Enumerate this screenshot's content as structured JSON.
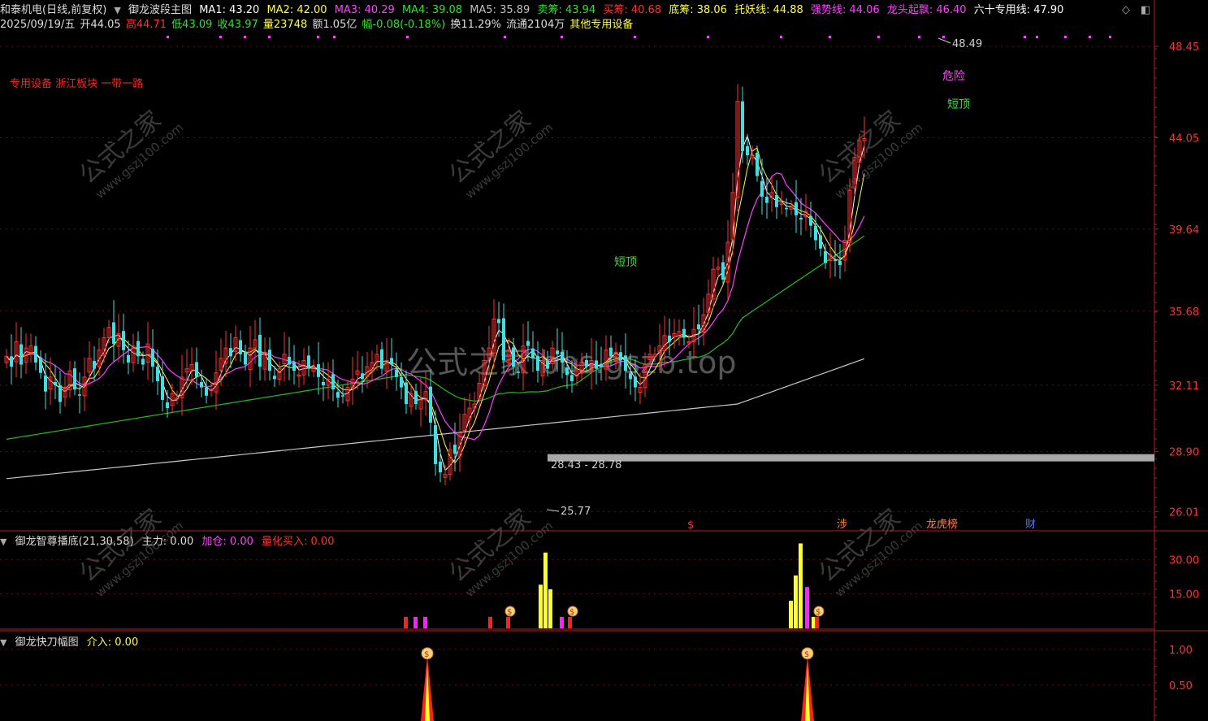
{
  "header": {
    "stock": "和泰机电(日线,前复权)",
    "main_indicator": "御龙波段主图",
    "ma": [
      {
        "label": "MA1: 43.20",
        "color": "#ffffff"
      },
      {
        "label": "MA2: 42.00",
        "color": "#ffff40"
      },
      {
        "label": "MA3: 40.29",
        "color": "#ff40ff"
      },
      {
        "label": "MA4: 39.08",
        "color": "#30e030"
      },
      {
        "label": "MA5: 35.89",
        "color": "#c0c0c0"
      },
      {
        "label": "卖筹: 43.94",
        "color": "#30e030"
      },
      {
        "label": "买筹: 40.68",
        "color": "#ff3030"
      },
      {
        "label": "底筹: 38.06",
        "color": "#ffff40"
      },
      {
        "label": "托妖线: 44.88",
        "color": "#ffff40"
      },
      {
        "label": "强势线: 44.06",
        "color": "#ff40ff"
      },
      {
        "label": "龙头起飘: 46.40",
        "color": "#ff40ff"
      },
      {
        "label": "六十专用线: 47.90",
        "color": "#ffffff"
      }
    ]
  },
  "quote": {
    "date": "2025/09/19/五",
    "open": "开44.05",
    "high": "高44.71",
    "low": "低43.09",
    "close": "收43.97",
    "volume": "量23748",
    "amount": "额1.05亿",
    "change": "幅-0.08(-0.18%)",
    "turnover": "换11.29%",
    "float": "流通2104万",
    "industry": "其他专用设备"
  },
  "tags": "专用设备 浙江板块 一带一路",
  "annotations": {
    "danger": "危险",
    "short_top_1": "短顶",
    "short_top_2": "短顶",
    "high_label": "48.49",
    "low_label": "25.77",
    "range_label": "28.43 - 28.78"
  },
  "events": [
    {
      "label": "$",
      "color": "#ff3030"
    },
    {
      "label": "涉",
      "color": "#ff8040"
    },
    {
      "label": "龙虎榜",
      "color": "#ff8040"
    },
    {
      "label": "财",
      "color": "#4080ff"
    }
  ],
  "panel2": {
    "title": "御龙智尊播底(21,30,58)",
    "zhuli": "主力: 0.00",
    "jiacang": "加仓: 0.00",
    "lianghua": "量化买入: 0.00"
  },
  "panel3": {
    "title": "御龙快刀幅图",
    "jieru": "介入: 0.00"
  },
  "watermark": {
    "center": "公式之家 bbs.gszb.top",
    "diag_cn": "公式之家",
    "diag_url": "www.gszj100.com"
  },
  "chart_data": [
    {
      "type": "candlestick",
      "title": "御龙波段主图",
      "y_ticks": [
        26.01,
        28.9,
        32.11,
        35.68,
        39.64,
        44.05,
        48.45
      ],
      "ylim": [
        25.2,
        49.2
      ],
      "x": [
        0,
        6,
        12,
        18,
        24,
        30,
        36,
        42,
        48,
        54,
        60,
        66,
        72,
        78,
        84,
        90,
        96,
        102,
        108,
        114,
        120,
        126,
        132,
        138,
        144,
        150,
        156,
        162,
        168,
        174,
        180,
        186,
        192,
        198,
        204,
        210,
        216,
        222,
        228,
        234,
        240,
        246,
        252,
        258,
        264,
        270,
        276,
        282,
        288,
        294,
        300,
        306,
        312,
        318,
        324,
        330,
        336,
        342,
        348,
        354,
        360,
        366,
        372,
        378,
        384,
        390,
        396,
        402,
        408,
        414,
        420,
        426,
        432,
        438,
        444,
        450,
        456,
        462,
        468,
        474,
        480,
        486,
        492,
        498,
        504,
        510,
        516,
        522,
        528,
        534,
        540,
        546,
        552,
        558,
        564,
        570,
        576,
        582,
        588,
        594,
        600,
        606,
        612,
        618,
        624,
        630,
        636,
        642,
        648,
        654,
        660,
        666,
        672,
        678,
        684,
        690,
        696,
        702,
        708,
        714,
        720,
        726,
        732,
        738,
        744,
        750,
        756,
        762,
        768,
        774,
        780,
        786,
        792,
        798,
        804,
        810,
        816,
        822,
        828,
        834,
        840,
        846,
        852,
        858,
        864,
        870,
        876,
        882,
        888,
        894,
        900,
        906,
        912,
        918,
        924,
        930,
        936,
        942,
        948,
        954,
        960,
        966,
        972,
        978,
        984,
        990,
        996,
        1002,
        1008,
        1014,
        1020,
        1026,
        1032,
        1038,
        1044,
        1050,
        1056,
        1062,
        1068,
        1074,
        1080,
        1086,
        1092,
        1098,
        1104,
        1110,
        1116,
        1122,
        1128,
        1134,
        1140,
        1146,
        1152,
        1158,
        1164,
        1170,
        1176,
        1182,
        1188,
        1194,
        1200,
        1206,
        1212,
        1218,
        1224,
        1230,
        1236,
        1242,
        1248,
        1254,
        1260,
        1266,
        1272,
        1278,
        1284,
        1290,
        1296,
        1302,
        1308,
        1314,
        1320,
        1326,
        1332,
        1338,
        1344,
        1350,
        1356,
        1362,
        1368,
        1374,
        1380,
        1386,
        1392,
        1398
      ],
      "close": [
        33.5,
        33.0,
        34.2,
        33.1,
        33.9,
        34.0,
        33.2,
        32.7,
        31.8,
        32.5,
        32.1,
        31.3,
        32.0,
        32.8,
        31.9,
        31.6,
        32.5,
        33.4,
        32.9,
        33.8,
        34.4,
        34.9,
        34.1,
        34.6,
        33.8,
        33.2,
        34.0,
        33.5,
        33.1,
        34.1,
        33.0,
        32.3,
        31.4,
        31.0,
        31.7,
        31.5,
        32.5,
        32.9,
        33.1,
        32.5,
        32.0,
        31.6,
        31.9,
        32.7,
        33.4,
        33.9,
        33.5,
        34.4,
        33.6,
        33.1,
        33.9,
        34.3,
        33.0,
        33.7,
        32.8,
        32.4,
        32.9,
        33.6,
        33.1,
        32.8,
        32.6,
        33.3,
        32.9,
        33.0,
        32.5,
        32.1,
        32.4,
        31.9,
        31.5,
        31.6,
        32.0,
        32.4,
        32.8,
        32.4,
        33.0,
        33.2,
        33.6,
        32.9,
        33.3,
        33.1,
        32.5,
        32.0,
        31.2,
        31.7,
        31.2,
        31.4,
        31.8,
        30.3,
        28.3,
        27.9,
        27.8,
        29.0,
        28.8,
        29.8,
        30.7,
        31.0,
        31.2,
        32.2,
        33.3,
        33.9,
        35.3,
        35.1,
        33.3,
        33.8,
        33.0,
        32.7,
        34.0,
        34.0,
        33.4,
        32.8,
        33.3,
        32.9,
        33.9,
        33.6,
        33.2,
        32.6,
        32.3,
        32.8,
        33.2,
        33.0,
        33.3,
        32.9,
        33.0,
        33.8,
        33.5,
        33.7,
        33.3,
        32.8,
        32.4,
        32.0,
        32.0,
        33.1,
        33.6,
        33.6,
        34.0,
        34.5,
        34.2,
        34.6,
        34.7,
        34.4,
        34.2,
        34.8,
        34.8,
        35.5,
        36.5,
        37.7,
        37.8,
        37.2,
        39.0,
        41.4,
        45.8,
        43.4,
        43.2,
        43.2,
        42.2,
        41.2,
        40.9,
        41.4,
        40.7,
        40.9,
        40.6,
        40.7,
        40.3,
        40.1,
        40.5,
        39.8,
        39.1,
        38.7,
        38.0,
        38.4,
        38.1,
        37.9,
        39.1,
        41.5,
        43.1,
        43.9,
        44.0
      ],
      "ma_series": [
        "MA1 white",
        "MA2 yellow",
        "MA3 magenta",
        "MA4 green",
        "MA5 grey"
      ]
    },
    {
      "type": "bar",
      "title": "御龙智尊播底(21,30,58)",
      "y_ticks": [
        15.0,
        30.0
      ],
      "series": [
        {
          "name": "主力",
          "color": "#ffff20",
          "values": [
            {
              "x": 666,
              "y": 19
            },
            {
              "x": 672,
              "y": 33
            },
            {
              "x": 678,
              "y": 17
            },
            {
              "x": 974,
              "y": 12
            },
            {
              "x": 980,
              "y": 23
            },
            {
              "x": 986,
              "y": 37
            },
            {
              "x": 1002,
              "y": 5
            }
          ]
        },
        {
          "name": "加仓",
          "color": "#ff20ff",
          "values": [
            {
              "x": 512,
              "y": 5
            },
            {
              "x": 524,
              "y": 5
            },
            {
              "x": 692,
              "y": 5
            },
            {
              "x": 994,
              "y": 18
            }
          ]
        },
        {
          "name": "量化买入",
          "color": "#ff2020",
          "values": [
            {
              "x": 500,
              "y": 5
            },
            {
              "x": 604,
              "y": 5
            },
            {
              "x": 626,
              "y": 5
            },
            {
              "x": 702,
              "y": 5
            },
            {
              "x": 1006,
              "y": 5
            }
          ]
        }
      ]
    },
    {
      "type": "area",
      "title": "御龙快刀幅图",
      "y_ticks": [
        0.5,
        1.0
      ],
      "series": [
        {
          "name": "介入",
          "values": [
            {
              "x": 526,
              "y": 1.0
            },
            {
              "x": 994,
              "y": 1.0
            }
          ]
        }
      ]
    }
  ]
}
